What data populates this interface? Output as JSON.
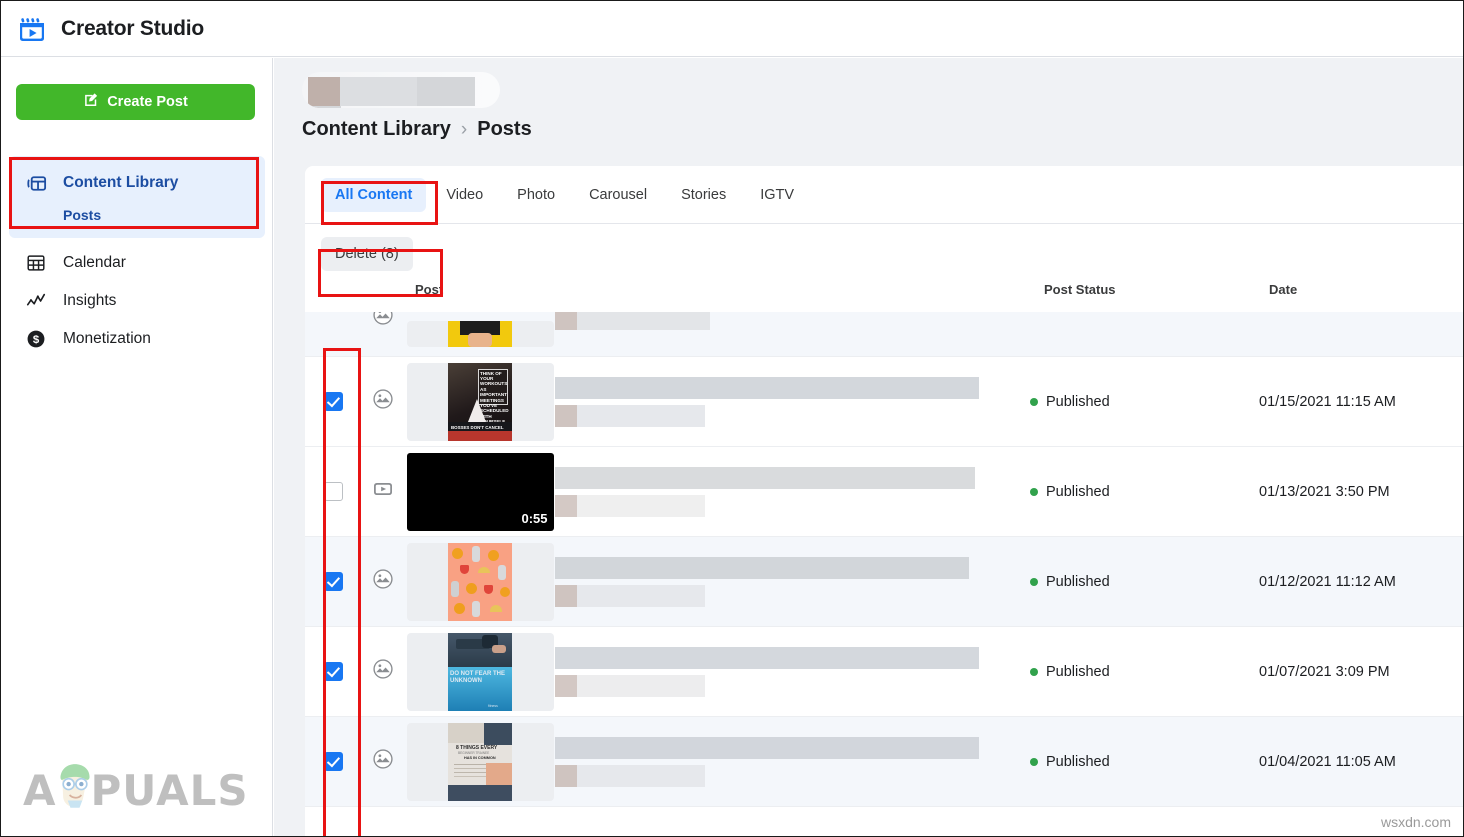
{
  "app": {
    "title": "Creator Studio",
    "brand_icon": "video-clapperboard-icon",
    "accent_blue": "#1877f2",
    "accent_green": "#42b72a",
    "annotation_red": "#e81313"
  },
  "sidebar": {
    "create_post": {
      "label": "Create Post",
      "icon": "compose-pencil-icon"
    },
    "items": [
      {
        "label": "Content Library",
        "icon": "content-library-icon",
        "active": true,
        "sub": "Posts"
      },
      {
        "label": "Calendar",
        "icon": "calendar-grid-icon",
        "active": false
      },
      {
        "label": "Insights",
        "icon": "insights-chart-icon",
        "active": false
      },
      {
        "label": "Monetization",
        "icon": "dollar-circle-icon",
        "active": false
      }
    ]
  },
  "breadcrumb": {
    "parent": "Content Library",
    "separator": "›",
    "current": "Posts"
  },
  "tabs": [
    {
      "label": "All Content",
      "active": true
    },
    {
      "label": "Video",
      "active": false
    },
    {
      "label": "Photo",
      "active": false
    },
    {
      "label": "Carousel",
      "active": false
    },
    {
      "label": "Stories",
      "active": false
    },
    {
      "label": "IGTV",
      "active": false
    }
  ],
  "actions": {
    "delete_label": "Delete (8)"
  },
  "table": {
    "columns": [
      "Post",
      "Post Status",
      "Date"
    ],
    "rows": [
      {
        "checked": false,
        "partial": true,
        "shaded": true,
        "type_icon": "photo-icon",
        "thumb": "yellow-photo",
        "status": "",
        "date": ""
      },
      {
        "checked": true,
        "shaded": false,
        "type_icon": "photo-icon",
        "thumb": "workout-quote-photo",
        "status": "Published",
        "date": "01/15/2021 11:15 AM"
      },
      {
        "checked": false,
        "shaded": false,
        "type_icon": "video-icon",
        "thumb": "video-black",
        "duration": "0:55",
        "status": "Published",
        "date": "01/13/2021 3:50 PM"
      },
      {
        "checked": true,
        "shaded": true,
        "type_icon": "photo-icon",
        "thumb": "food-pattern-photo",
        "status": "Published",
        "date": "01/12/2021 11:12 AM"
      },
      {
        "checked": true,
        "shaded": false,
        "type_icon": "photo-icon",
        "thumb": "pool-photo",
        "status": "Published",
        "date": "01/07/2021 3:09 PM"
      },
      {
        "checked": true,
        "shaded": true,
        "type_icon": "photo-icon",
        "thumb": "things-every-photo",
        "status": "Published",
        "date": "01/04/2021 11:05 AM"
      }
    ]
  },
  "watermarks": {
    "left": "PUALS",
    "left_full": "APPUALS",
    "right": "wsxdn.com"
  },
  "annotations": [
    {
      "name": "sidebar-content-library-highlight"
    },
    {
      "name": "all-content-tab-highlight"
    },
    {
      "name": "delete-button-highlight"
    },
    {
      "name": "checkbox-column-highlight"
    }
  ]
}
